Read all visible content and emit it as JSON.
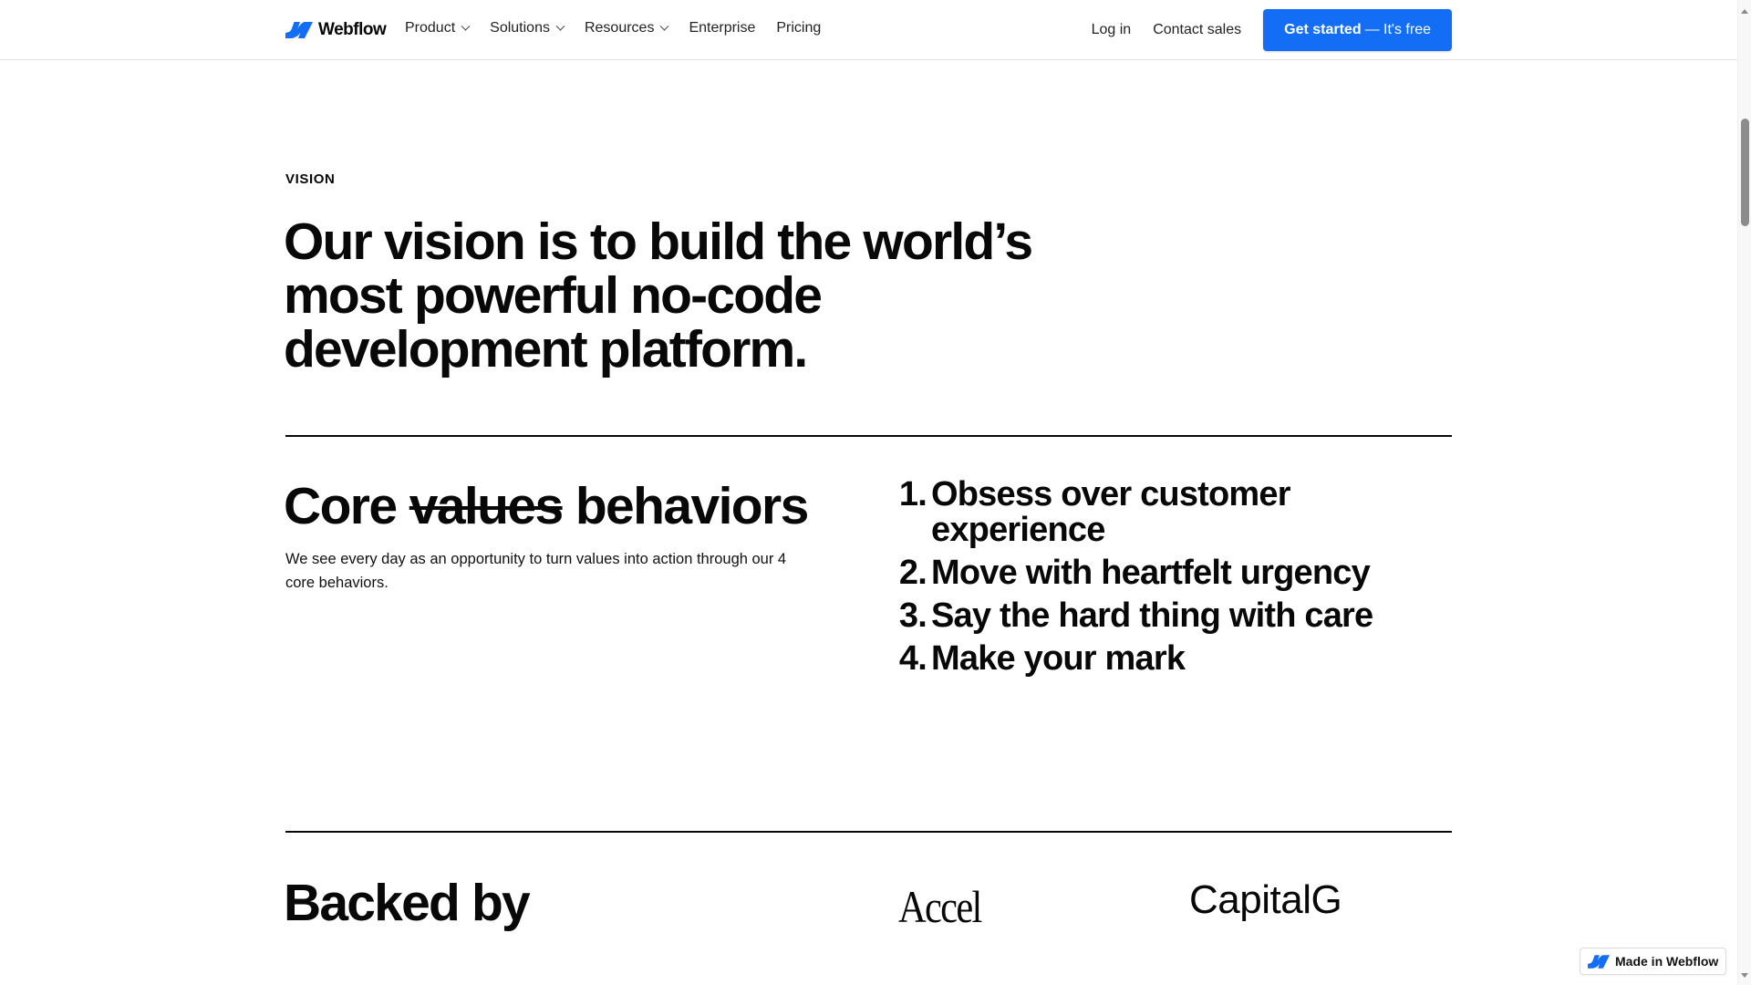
{
  "nav": {
    "brand": "Webflow",
    "links": [
      {
        "label": "Product",
        "has_dropdown": true
      },
      {
        "label": "Solutions",
        "has_dropdown": true
      },
      {
        "label": "Resources",
        "has_dropdown": true
      },
      {
        "label": "Enterprise",
        "has_dropdown": false
      },
      {
        "label": "Pricing",
        "has_dropdown": false
      }
    ],
    "login": "Log in",
    "contact": "Contact sales",
    "cta_bold": "Get started",
    "cta_light": "— It's free"
  },
  "vision": {
    "eyebrow": "VISION",
    "headline": "Our vision is to build the world’s most powerful no-code development platform."
  },
  "core": {
    "title_prefix": "Core",
    "title_struck": "values",
    "title_suffix": "behaviors",
    "description": "We see every day as an opportunity to turn values into action through our 4 core behaviors.",
    "behaviors": [
      {
        "num": "1.",
        "text": "Obsess over customer experience"
      },
      {
        "num": "2.",
        "text": "Move with heartfelt urgency"
      },
      {
        "num": "3.",
        "text": "Say the hard thing with care"
      },
      {
        "num": "4.",
        "text": "Make your mark"
      }
    ]
  },
  "backed": {
    "title": "Backed by",
    "investors": [
      "Accel",
      "CapitalG"
    ]
  },
  "badge": {
    "label": "Made in Webflow"
  },
  "colors": {
    "brand_blue": "#146ef5",
    "text": "#080808"
  }
}
